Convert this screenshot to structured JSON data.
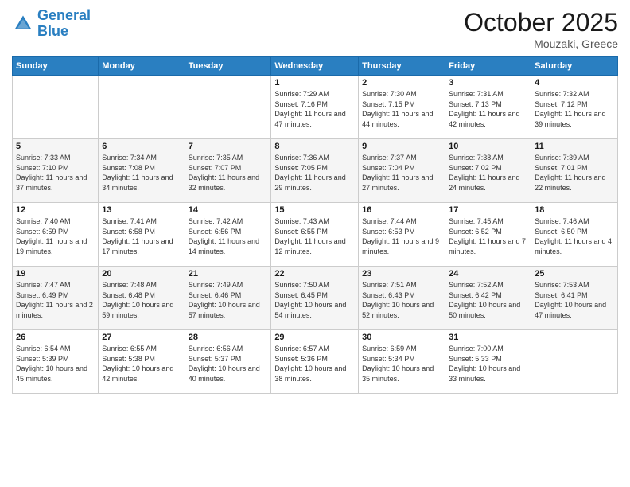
{
  "header": {
    "logo_line1": "General",
    "logo_line2": "Blue",
    "month": "October 2025",
    "location": "Mouzaki, Greece"
  },
  "weekdays": [
    "Sunday",
    "Monday",
    "Tuesday",
    "Wednesday",
    "Thursday",
    "Friday",
    "Saturday"
  ],
  "weeks": [
    [
      {
        "day": "",
        "info": ""
      },
      {
        "day": "",
        "info": ""
      },
      {
        "day": "",
        "info": ""
      },
      {
        "day": "1",
        "info": "Sunrise: 7:29 AM\nSunset: 7:16 PM\nDaylight: 11 hours and 47 minutes."
      },
      {
        "day": "2",
        "info": "Sunrise: 7:30 AM\nSunset: 7:15 PM\nDaylight: 11 hours and 44 minutes."
      },
      {
        "day": "3",
        "info": "Sunrise: 7:31 AM\nSunset: 7:13 PM\nDaylight: 11 hours and 42 minutes."
      },
      {
        "day": "4",
        "info": "Sunrise: 7:32 AM\nSunset: 7:12 PM\nDaylight: 11 hours and 39 minutes."
      }
    ],
    [
      {
        "day": "5",
        "info": "Sunrise: 7:33 AM\nSunset: 7:10 PM\nDaylight: 11 hours and 37 minutes."
      },
      {
        "day": "6",
        "info": "Sunrise: 7:34 AM\nSunset: 7:08 PM\nDaylight: 11 hours and 34 minutes."
      },
      {
        "day": "7",
        "info": "Sunrise: 7:35 AM\nSunset: 7:07 PM\nDaylight: 11 hours and 32 minutes."
      },
      {
        "day": "8",
        "info": "Sunrise: 7:36 AM\nSunset: 7:05 PM\nDaylight: 11 hours and 29 minutes."
      },
      {
        "day": "9",
        "info": "Sunrise: 7:37 AM\nSunset: 7:04 PM\nDaylight: 11 hours and 27 minutes."
      },
      {
        "day": "10",
        "info": "Sunrise: 7:38 AM\nSunset: 7:02 PM\nDaylight: 11 hours and 24 minutes."
      },
      {
        "day": "11",
        "info": "Sunrise: 7:39 AM\nSunset: 7:01 PM\nDaylight: 11 hours and 22 minutes."
      }
    ],
    [
      {
        "day": "12",
        "info": "Sunrise: 7:40 AM\nSunset: 6:59 PM\nDaylight: 11 hours and 19 minutes."
      },
      {
        "day": "13",
        "info": "Sunrise: 7:41 AM\nSunset: 6:58 PM\nDaylight: 11 hours and 17 minutes."
      },
      {
        "day": "14",
        "info": "Sunrise: 7:42 AM\nSunset: 6:56 PM\nDaylight: 11 hours and 14 minutes."
      },
      {
        "day": "15",
        "info": "Sunrise: 7:43 AM\nSunset: 6:55 PM\nDaylight: 11 hours and 12 minutes."
      },
      {
        "day": "16",
        "info": "Sunrise: 7:44 AM\nSunset: 6:53 PM\nDaylight: 11 hours and 9 minutes."
      },
      {
        "day": "17",
        "info": "Sunrise: 7:45 AM\nSunset: 6:52 PM\nDaylight: 11 hours and 7 minutes."
      },
      {
        "day": "18",
        "info": "Sunrise: 7:46 AM\nSunset: 6:50 PM\nDaylight: 11 hours and 4 minutes."
      }
    ],
    [
      {
        "day": "19",
        "info": "Sunrise: 7:47 AM\nSunset: 6:49 PM\nDaylight: 11 hours and 2 minutes."
      },
      {
        "day": "20",
        "info": "Sunrise: 7:48 AM\nSunset: 6:48 PM\nDaylight: 10 hours and 59 minutes."
      },
      {
        "day": "21",
        "info": "Sunrise: 7:49 AM\nSunset: 6:46 PM\nDaylight: 10 hours and 57 minutes."
      },
      {
        "day": "22",
        "info": "Sunrise: 7:50 AM\nSunset: 6:45 PM\nDaylight: 10 hours and 54 minutes."
      },
      {
        "day": "23",
        "info": "Sunrise: 7:51 AM\nSunset: 6:43 PM\nDaylight: 10 hours and 52 minutes."
      },
      {
        "day": "24",
        "info": "Sunrise: 7:52 AM\nSunset: 6:42 PM\nDaylight: 10 hours and 50 minutes."
      },
      {
        "day": "25",
        "info": "Sunrise: 7:53 AM\nSunset: 6:41 PM\nDaylight: 10 hours and 47 minutes."
      }
    ],
    [
      {
        "day": "26",
        "info": "Sunrise: 6:54 AM\nSunset: 5:39 PM\nDaylight: 10 hours and 45 minutes."
      },
      {
        "day": "27",
        "info": "Sunrise: 6:55 AM\nSunset: 5:38 PM\nDaylight: 10 hours and 42 minutes."
      },
      {
        "day": "28",
        "info": "Sunrise: 6:56 AM\nSunset: 5:37 PM\nDaylight: 10 hours and 40 minutes."
      },
      {
        "day": "29",
        "info": "Sunrise: 6:57 AM\nSunset: 5:36 PM\nDaylight: 10 hours and 38 minutes."
      },
      {
        "day": "30",
        "info": "Sunrise: 6:59 AM\nSunset: 5:34 PM\nDaylight: 10 hours and 35 minutes."
      },
      {
        "day": "31",
        "info": "Sunrise: 7:00 AM\nSunset: 5:33 PM\nDaylight: 10 hours and 33 minutes."
      },
      {
        "day": "",
        "info": ""
      }
    ]
  ]
}
